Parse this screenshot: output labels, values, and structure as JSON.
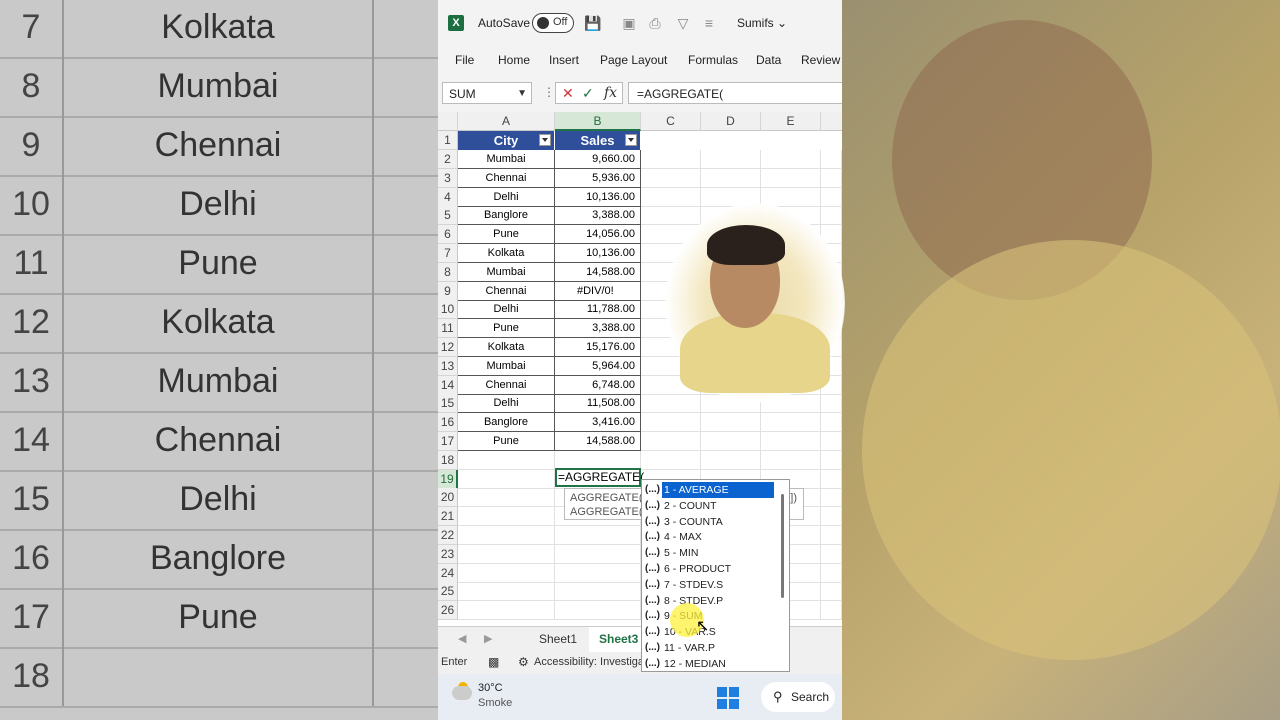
{
  "window": {
    "app_icon": "X",
    "autosave_label": "AutoSave",
    "autosave_state": "Off",
    "filename": "Sumifs ⌄"
  },
  "menu": [
    "File",
    "Home",
    "Insert",
    "Page Layout",
    "Formulas",
    "Data",
    "Review"
  ],
  "formula_bar": {
    "name_box": "SUM",
    "cancel": "✕",
    "enter": "✓",
    "fx": "fx",
    "formula": "=AGGREGATE("
  },
  "columns": [
    "A",
    "B",
    "C",
    "D",
    "E"
  ],
  "table": {
    "headers": [
      "City",
      "Sales"
    ],
    "rows": [
      {
        "row": "2",
        "city": "Mumbai",
        "sales": "9,660.00"
      },
      {
        "row": "3",
        "city": "Chennai",
        "sales": "5,936.00"
      },
      {
        "row": "4",
        "city": "Delhi",
        "sales": "10,136.00"
      },
      {
        "row": "5",
        "city": "Banglore",
        "sales": "3,388.00"
      },
      {
        "row": "6",
        "city": "Pune",
        "sales": "14,056.00"
      },
      {
        "row": "7",
        "city": "Kolkata",
        "sales": "10,136.00"
      },
      {
        "row": "8",
        "city": "Mumbai",
        "sales": "14,588.00"
      },
      {
        "row": "9",
        "city": "Chennai",
        "sales": "#DIV/0!"
      },
      {
        "row": "10",
        "city": "Delhi",
        "sales": "11,788.00"
      },
      {
        "row": "11",
        "city": "Pune",
        "sales": "3,388.00"
      },
      {
        "row": "12",
        "city": "Kolkata",
        "sales": "15,176.00"
      },
      {
        "row": "13",
        "city": "Mumbai",
        "sales": "5,964.00"
      },
      {
        "row": "14",
        "city": "Chennai",
        "sales": "6,748.00"
      },
      {
        "row": "15",
        "city": "Delhi",
        "sales": "11,508.00"
      },
      {
        "row": "16",
        "city": "Banglore",
        "sales": "3,416.00"
      },
      {
        "row": "17",
        "city": "Pune",
        "sales": "14,588.00"
      }
    ],
    "empty_rows": [
      "18",
      "19",
      "20",
      "21",
      "22",
      "23",
      "24",
      "25",
      "26"
    ]
  },
  "active_cell_text": "=AGGREGATE(",
  "tooltip_lines": [
    "AGGREGATE(fu",
    "AGGREGATE(fu"
  ],
  "tooltip_tail": "k])",
  "autocomplete": [
    {
      "icon": "(...)",
      "label": "1 - AVERAGE"
    },
    {
      "icon": "(...)",
      "label": "2 - COUNT"
    },
    {
      "icon": "(...)",
      "label": "3 - COUNTA"
    },
    {
      "icon": "(...)",
      "label": "4 - MAX"
    },
    {
      "icon": "(...)",
      "label": "5 - MIN"
    },
    {
      "icon": "(...)",
      "label": "6 - PRODUCT"
    },
    {
      "icon": "(...)",
      "label": "7 - STDEV.S"
    },
    {
      "icon": "(...)",
      "label": "8 - STDEV.P"
    },
    {
      "icon": "(...)",
      "label": "9 - SUM"
    },
    {
      "icon": "(...)",
      "label": "10 - VAR.S"
    },
    {
      "icon": "(...)",
      "label": "11 - VAR.P"
    },
    {
      "icon": "(...)",
      "label": "12 - MEDIAN"
    }
  ],
  "sheets": [
    "Sheet1",
    "Sheet3"
  ],
  "active_sheet": "Sheet3",
  "status": {
    "mode": "Enter",
    "accessibility": "Accessibility: Investigat"
  },
  "taskbar": {
    "temp": "30°C",
    "weather": "Smoke",
    "search": "Search"
  },
  "background_grid": {
    "rows": [
      {
        "num": "7",
        "city": "Kolkata"
      },
      {
        "num": "8",
        "city": "Mumbai"
      },
      {
        "num": "9",
        "city": "Chennai"
      },
      {
        "num": "10",
        "city": "Delhi"
      },
      {
        "num": "11",
        "city": "Pune"
      },
      {
        "num": "12",
        "city": "Kolkata"
      },
      {
        "num": "13",
        "city": "Mumbai"
      },
      {
        "num": "14",
        "city": "Chennai"
      },
      {
        "num": "15",
        "city": "Delhi"
      },
      {
        "num": "16",
        "city": "Banglore"
      },
      {
        "num": "17",
        "city": "Pune"
      },
      {
        "num": "18",
        "city": ""
      }
    ]
  },
  "colors": {
    "table_header": "#2f4f9a",
    "excel_green": "#217346",
    "dropdown_selected": "#0b63cf"
  }
}
